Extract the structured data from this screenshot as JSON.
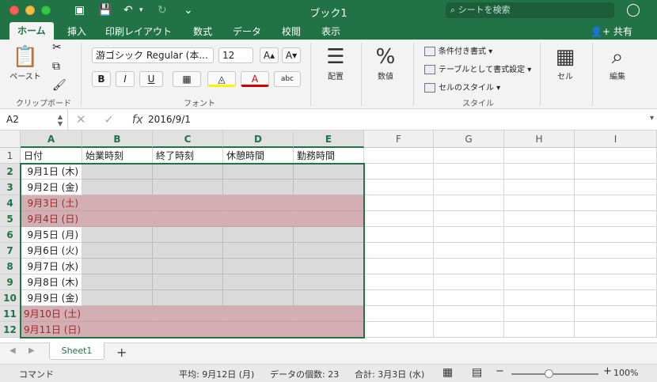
{
  "window": {
    "title": "ブック1",
    "search_placeholder": "シートを検索"
  },
  "ribbon_tabs": [
    "ホーム",
    "挿入",
    "印刷レイアウト",
    "数式",
    "データ",
    "校閲",
    "表示"
  ],
  "share_label": "共有",
  "clipboard": {
    "paste": "ペースト",
    "group": "クリップボード"
  },
  "font": {
    "name": "游ゴシック Regular (本...",
    "size": "12",
    "group": "フォント",
    "bold": "B",
    "italic": "I",
    "underline": "U",
    "abc": "abc"
  },
  "alignment": {
    "label": "配置"
  },
  "number": {
    "label": "数値"
  },
  "styles": {
    "conditional": "条件付き書式",
    "table": "テーブルとして書式設定",
    "cell_style": "セルのスタイル",
    "group": "スタイル"
  },
  "cells_group": {
    "label": "セル"
  },
  "editing": {
    "label": "編集"
  },
  "formula_bar": {
    "name_box": "A2",
    "value": "2016/9/1",
    "fx": "fx"
  },
  "columns": [
    "A",
    "B",
    "C",
    "D",
    "E",
    "F",
    "G",
    "H",
    "I"
  ],
  "rows": [
    "1",
    "2",
    "3",
    "4",
    "5",
    "6",
    "7",
    "8",
    "9",
    "10",
    "11",
    "12"
  ],
  "headers": [
    "日付",
    "始業時刻",
    "終了時刻",
    "休憩時間",
    "勤務時間"
  ],
  "dates": [
    "9月1日 (木)",
    "9月2日 (金)",
    "9月3日 (土)",
    "9月4日 (日)",
    "9月5日 (月)",
    "9月6日 (火)",
    "9月7日 (水)",
    "9月8日 (木)",
    "9月9日 (金)",
    "9月10日 (土)",
    "9月11日 (日)"
  ],
  "weekend_rows": [
    2,
    3,
    9,
    10
  ],
  "sheet": {
    "tab": "Sheet1",
    "add": "+"
  },
  "status": {
    "mode": "コマンド",
    "average": "平均: 9月12日 (月)",
    "count": "データの個数: 23",
    "sum": "合計: 3月3日 (水)",
    "zoom": "100%",
    "zoom_level": 1.0
  },
  "colors": {
    "accent": "#217346",
    "weekend": "#d3afb4",
    "selection": "#dadada"
  }
}
